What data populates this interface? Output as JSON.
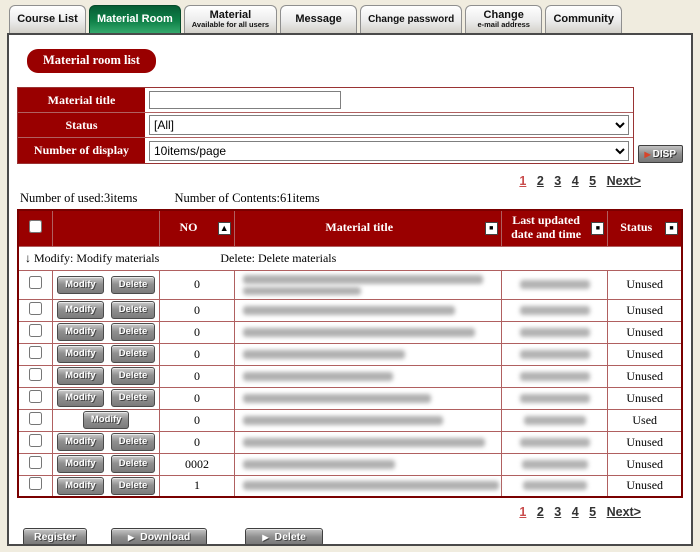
{
  "colors": {
    "accent_red": "#990000",
    "table_outer_border": "#7a0000",
    "table_inner_border": "#b06060",
    "tab_active_green": "#0f8148",
    "page_background": "#f0ecdf",
    "link_color": "#333333",
    "current_page_color": "#c94c4c"
  },
  "icons": {
    "sort_asc": "▲",
    "sort_box": "■",
    "disp_arrow": "▶",
    "button_arrow": "▶"
  },
  "tabs": [
    {
      "label": "Course List"
    },
    {
      "label": "Material Room",
      "active": true
    },
    {
      "label": "Material",
      "sublabel": "Available for all users"
    },
    {
      "label": "Message"
    },
    {
      "label": "Change password"
    },
    {
      "label": "Change",
      "sublabel": "e-mail address"
    },
    {
      "label": "Community"
    }
  ],
  "page": {
    "badge": "Material room list"
  },
  "search_form": {
    "material_title": {
      "label": "Material title",
      "value": "",
      "placeholder": ""
    },
    "status": {
      "label": "Status",
      "value": "[All]"
    },
    "display": {
      "label": "Number of display",
      "value": "10items/page"
    },
    "disp_button": "DISP"
  },
  "summary": {
    "used": "Number of used:3items",
    "contents": "Number of Contents:61items"
  },
  "pagination": {
    "pages": [
      "1",
      "2",
      "3",
      "4",
      "5"
    ],
    "next": "Next>",
    "current": "1"
  },
  "table": {
    "headers": {
      "no": "NO",
      "title": "Material title",
      "updated": "Last updated date and time",
      "status": "Status"
    },
    "note_modify": "↓ Modify: Modify materials",
    "note_delete": "Delete: Delete materials",
    "modify_label": "Modify",
    "delete_label": "Delete",
    "rows": [
      {
        "no": "0",
        "status": "Unused"
      },
      {
        "no": "0",
        "status": "Unused"
      },
      {
        "no": "0",
        "status": "Unused"
      },
      {
        "no": "0",
        "status": "Unused"
      },
      {
        "no": "0",
        "status": "Unused"
      },
      {
        "no": "0",
        "status": "Unused"
      },
      {
        "no": "0",
        "status": "Used"
      },
      {
        "no": "0",
        "status": "Unused"
      },
      {
        "no": "0002",
        "status": "Unused"
      },
      {
        "no": "1",
        "status": "Unused"
      }
    ]
  },
  "footer_buttons": {
    "register": "Register",
    "download": "Download",
    "delete": "Delete"
  }
}
